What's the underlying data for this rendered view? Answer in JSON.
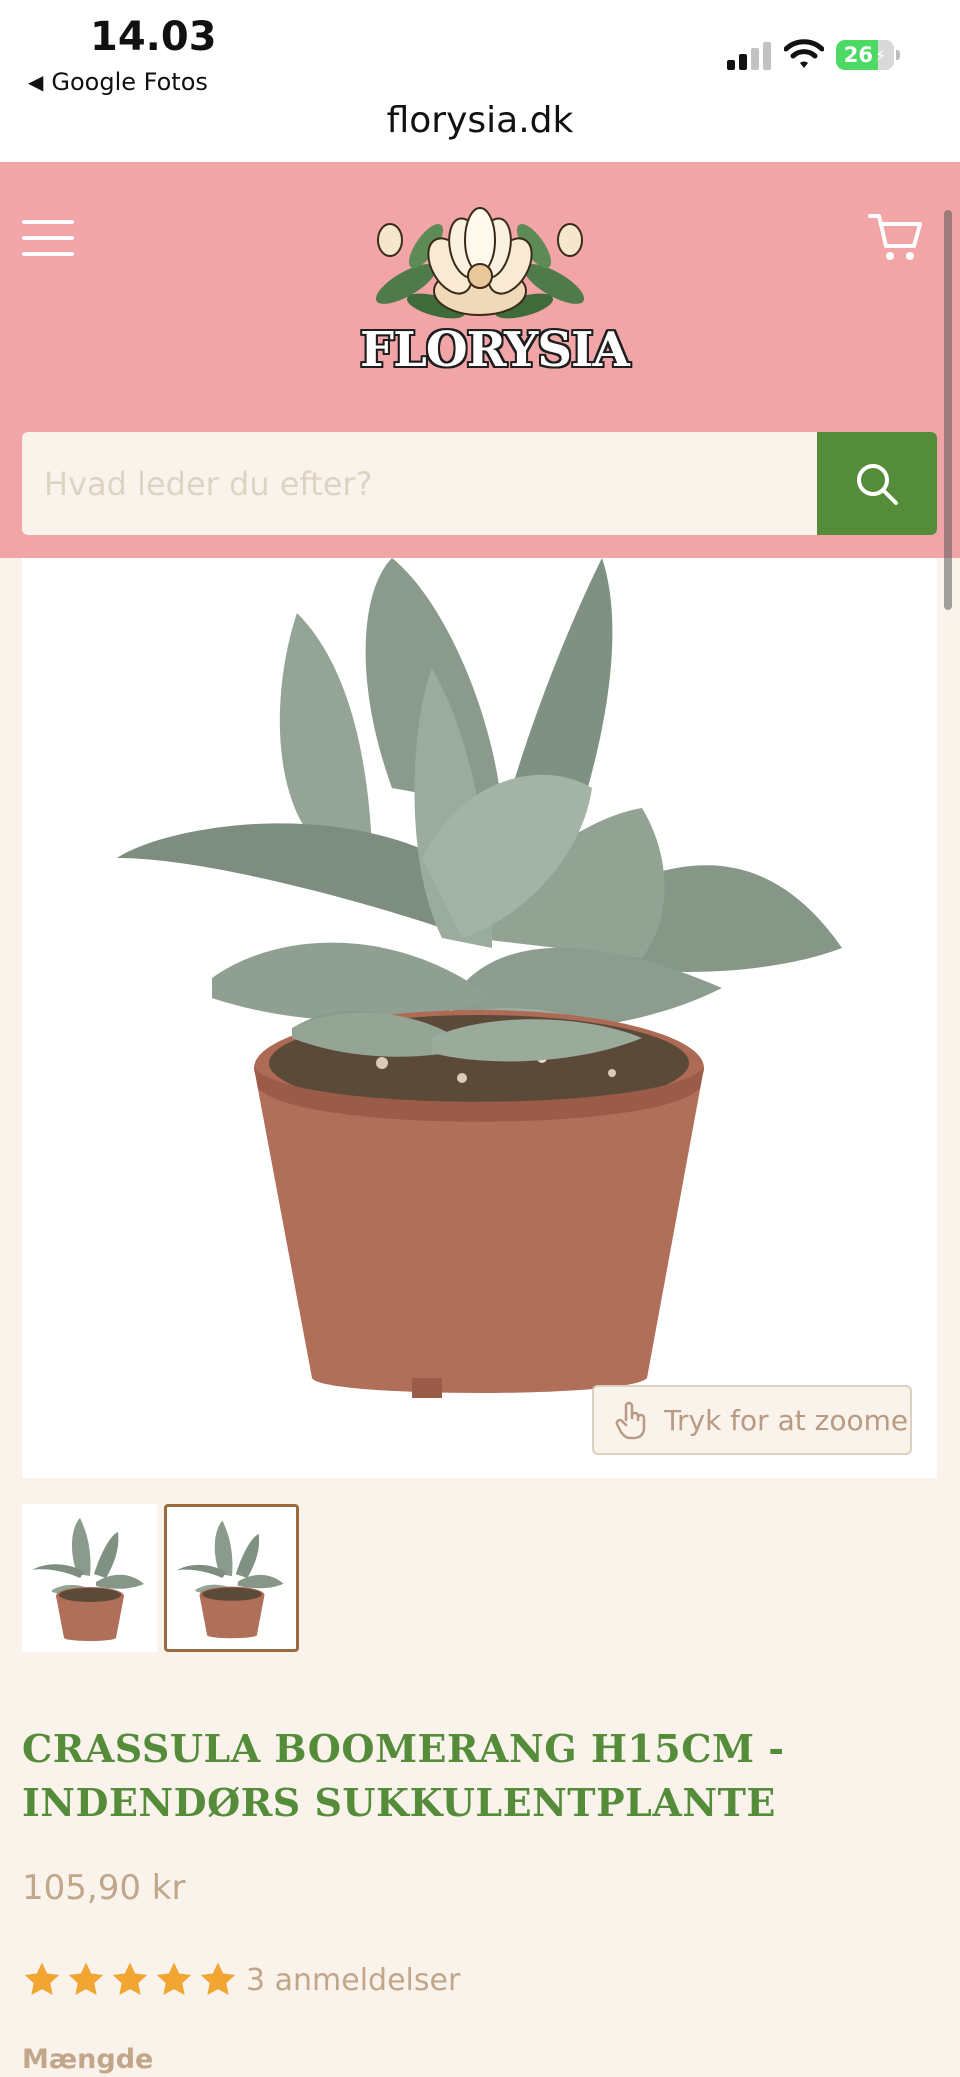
{
  "status_bar": {
    "time": "14.03",
    "back_app": "Google Fotos",
    "battery_level": "26",
    "url": "florysia.dk"
  },
  "header": {
    "logo_text": "FLORYSIA",
    "search_placeholder": "Hvad leder du efter?",
    "background_color": "#f1a5a6",
    "accent_color": "#548c3a"
  },
  "product": {
    "zoom_label": "Tryk for at zoome",
    "title": "CRASSULA BOOMERANG H15CM - INDENDØRS SUKKULENTPLANTE",
    "price": "105,90 kr",
    "rating_stars": 5,
    "review_count": "3 anmeldelser",
    "quantity_label": "Mængde",
    "selected_thumbnail": 2
  },
  "icons": [
    "menu-icon",
    "cart-icon",
    "search-icon",
    "tap-hand-icon",
    "star-icon",
    "signal-icon",
    "wifi-icon",
    "battery-icon",
    "back-caret-icon"
  ]
}
